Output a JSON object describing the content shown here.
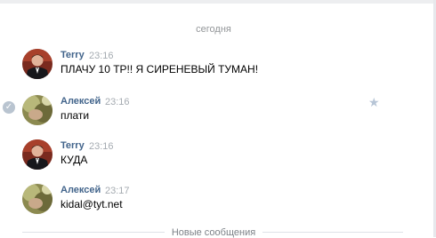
{
  "date_separator": "сегодня",
  "messages": [
    {
      "author": "Terry",
      "time": "23:16",
      "text": "ПЛАЧУ 10 ТР!! Я СИРЕНЕВЫЙ ТУМАН!",
      "avatar": "avatar-man-in-suit-icon"
    },
    {
      "author": "Алексей",
      "time": "23:16",
      "text": "плати",
      "avatar": "avatar-blurry-photo-icon",
      "selected": true
    },
    {
      "author": "Terry",
      "time": "23:16",
      "text": "КУДА",
      "avatar": "avatar-man-in-suit-icon"
    },
    {
      "author": "Алексей",
      "time": "23:17",
      "text": "kidal@tyt.net",
      "avatar": "avatar-blurry-photo-icon"
    }
  ],
  "new_messages_label": "Новые сообщения",
  "colors": {
    "author": "#42648b",
    "time": "#a5abb1",
    "accent": "#b7c5d6"
  }
}
